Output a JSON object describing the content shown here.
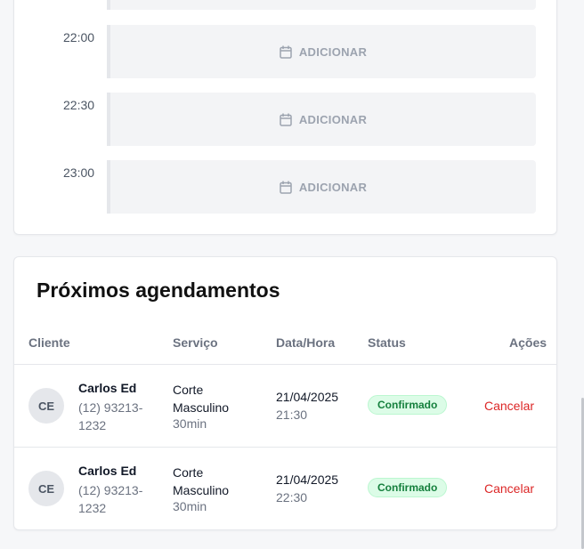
{
  "schedule": {
    "slots": [
      {
        "time": "22:00",
        "action_label": "ADICIONAR"
      },
      {
        "time": "22:30",
        "action_label": "ADICIONAR"
      },
      {
        "time": "23:00",
        "action_label": "ADICIONAR"
      }
    ],
    "icon": "calendar-icon"
  },
  "appointments": {
    "title": "Próximos agendamentos",
    "columns": {
      "client": "Cliente",
      "service": "Serviço",
      "datetime": "Data/Hora",
      "status": "Status",
      "actions": "Ações"
    },
    "rows": [
      {
        "initials": "CE",
        "name": "Carlos Ed",
        "phone": "(12) 93213-1232",
        "service": "Corte Masculino",
        "duration": "30min",
        "date": "21/04/2025",
        "time": "21:30",
        "status": "Confirmado",
        "action": "Cancelar"
      },
      {
        "initials": "CE",
        "name": "Carlos Ed",
        "phone": "(12) 93213-1232",
        "service": "Corte Masculino",
        "duration": "30min",
        "date": "21/04/2025",
        "time": "22:30",
        "status": "Confirmado",
        "action": "Cancelar"
      }
    ]
  },
  "colors": {
    "status_confirmed": "#15803d",
    "cancel": "#dc2626",
    "slot_bg": "#f3f4f6"
  }
}
